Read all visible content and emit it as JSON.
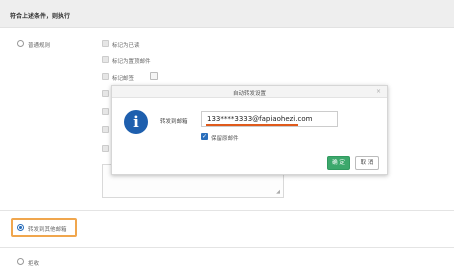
{
  "section": {
    "title": "符合上述条件，则执行"
  },
  "left_options": {
    "normal_rule": "普通规则",
    "forward_other": "转发到其他邮箱",
    "reject": "拒收"
  },
  "actions": [
    {
      "label": "标记为已读"
    },
    {
      "label": "标记为置顶邮件"
    },
    {
      "label": "标记邮签"
    }
  ],
  "dialog": {
    "title": "自动转发设置",
    "close": "×",
    "info_icon": "i",
    "field_label": "转发到邮箱",
    "email_value": "133****3333@fapiaohezi.com",
    "keep_original_label": "保留原邮件",
    "keep_original_checked": true,
    "ok_label": "确 定",
    "cancel_label": "取 消"
  },
  "icons": {
    "info": "info-icon",
    "close": "close-icon",
    "check": "check-icon"
  },
  "colors": {
    "primary": "#2a6ebb",
    "ok_button": "#3ca86c",
    "highlight_border": "#f0a64d",
    "underline": "#e05a1b"
  }
}
